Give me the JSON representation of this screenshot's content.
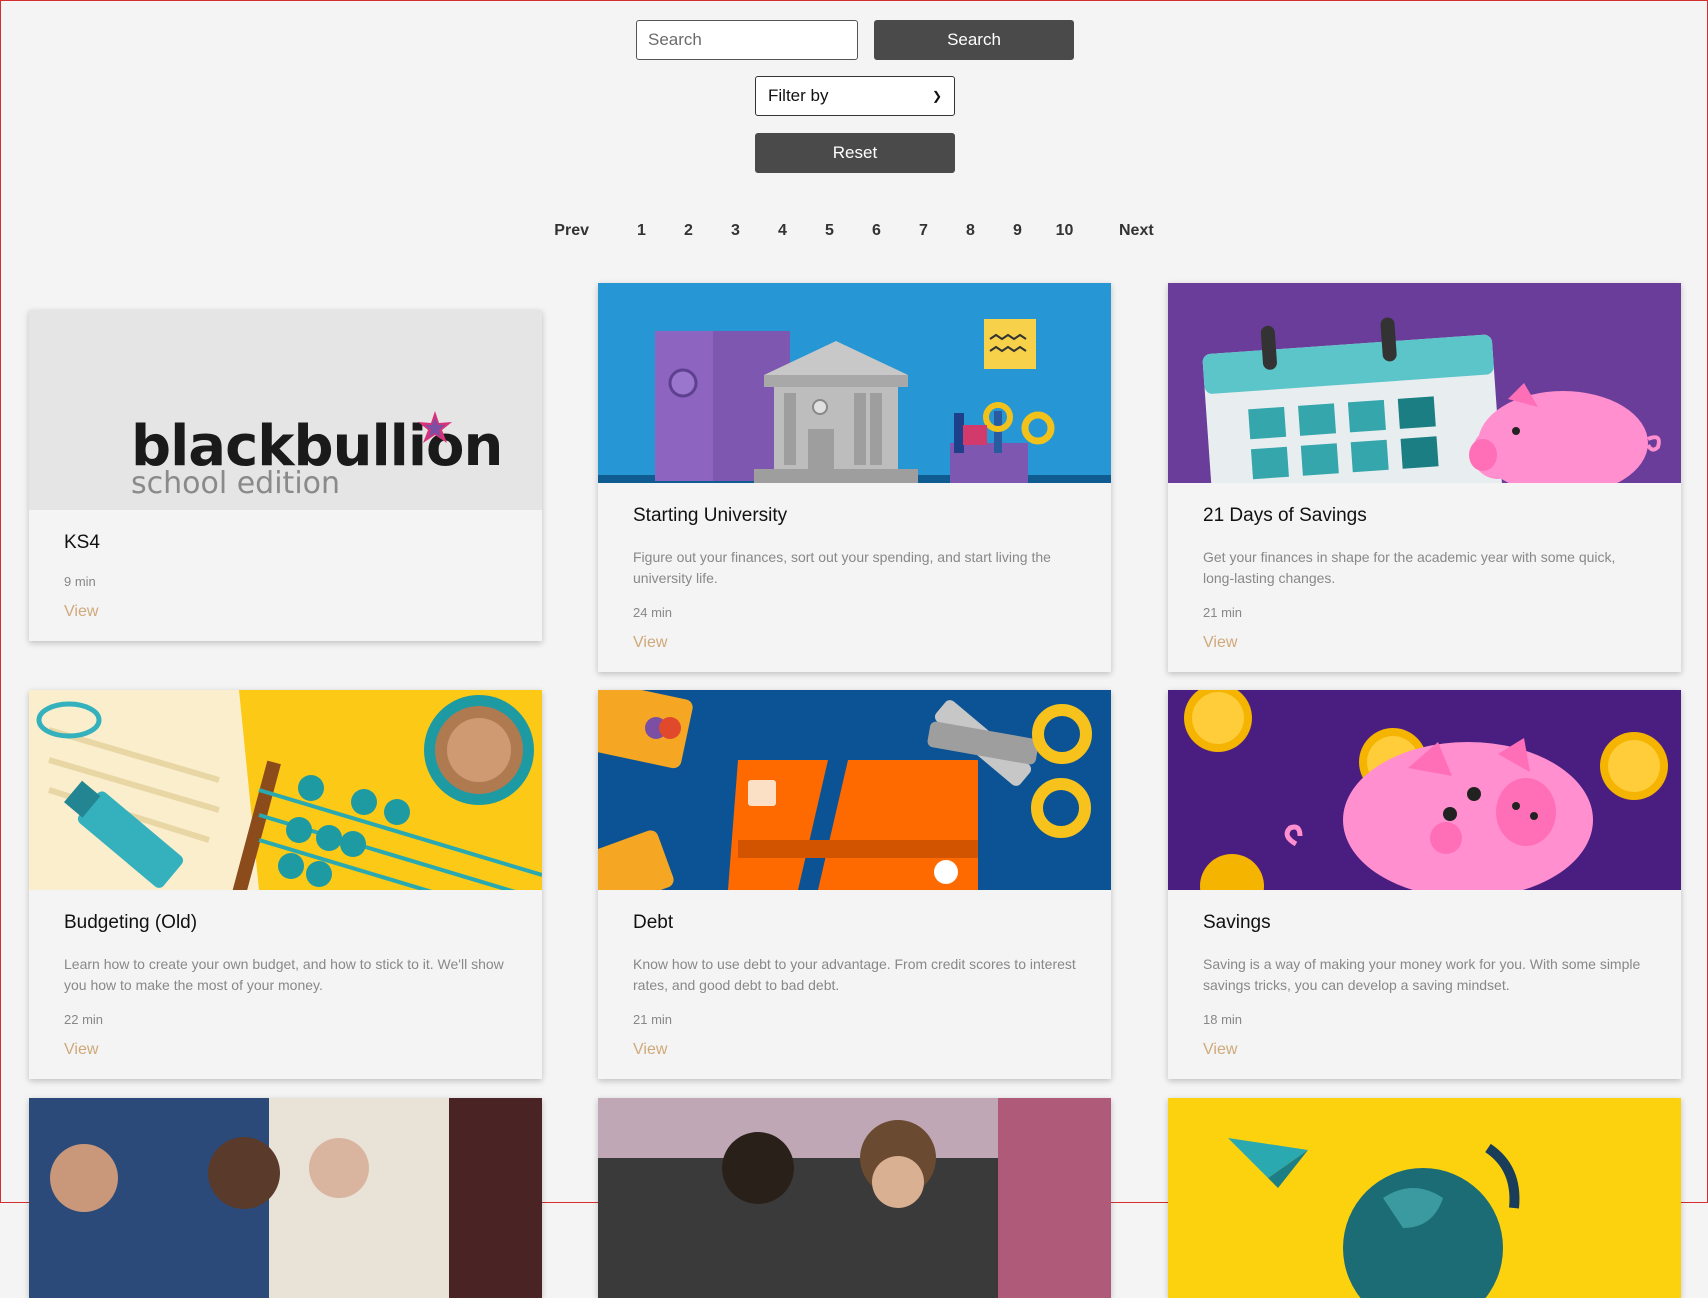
{
  "search": {
    "placeholder": "Search",
    "button_label": "Search"
  },
  "filter": {
    "selected": "Filter by"
  },
  "reset": {
    "label": "Reset"
  },
  "pagination": {
    "prev": "Prev",
    "pages": [
      "1",
      "2",
      "3",
      "4",
      "5",
      "6",
      "7",
      "8",
      "9",
      "10"
    ],
    "next": "Next"
  },
  "logo": {
    "word": "blackbullion",
    "edition": "school edition"
  },
  "cards": [
    {
      "title": "KS4",
      "description": "",
      "duration": "9 min",
      "view": "View"
    },
    {
      "title": "Starting University",
      "description": "Figure out your finances, sort out your spending, and start living the university life.",
      "duration": "24 min",
      "view": "View"
    },
    {
      "title": "21 Days of Savings",
      "description": "Get your finances in shape for the academic year with some quick, long-lasting changes.",
      "duration": "21 min",
      "view": "View"
    },
    {
      "title": "Budgeting (Old)",
      "description": "Learn how to create your own budget, and how to stick to it. We'll show you how to make the most of your money.",
      "duration": "22 min",
      "view": "View"
    },
    {
      "title": "Debt",
      "description": "Know how to use debt to your advantage. From credit scores to interest rates, and good debt to bad debt.",
      "duration": "21 min",
      "view": "View"
    },
    {
      "title": "Savings",
      "description": "Saving is a way of making your money work for you. With some simple savings tricks, you can develop a saving mindset.",
      "duration": "18 min",
      "view": "View"
    }
  ],
  "colors": {
    "dark_button": "#4a4a4a",
    "view_link": "#cfa97a",
    "page_bg": "#f4f4f4"
  }
}
